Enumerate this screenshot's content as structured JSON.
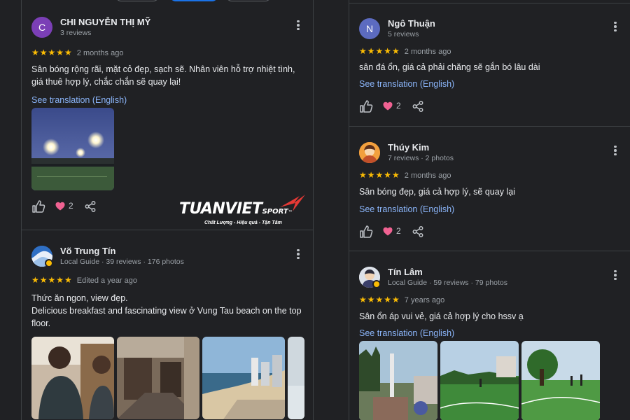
{
  "left": {
    "reviews": [
      {
        "avatar_letter": "C",
        "name": "CHI NGUYỄN THỊ MỸ",
        "meta": "3 reviews",
        "stars": "★★★★★",
        "when": "2 months ago",
        "text": "Sân bóng rộng rãi, mặt cỏ đẹp, sạch sẽ. Nhân viên hỗ trợ nhiệt tình, giá thuê hợp lý, chắc chắn sẽ quay lại!",
        "translate": "See translation (English)",
        "likes": "2"
      },
      {
        "name": "Võ Trung Tín",
        "meta": "Local Guide · 39 reviews · 176 photos",
        "stars": "★★★★★",
        "when": "Edited a year ago",
        "text_line1": "Thức ăn ngon, view đẹp.",
        "text_line2": "Delicious breakfast and fascinating view ở Vung Tau beach on the top floor."
      }
    ]
  },
  "right": {
    "reviews": [
      {
        "avatar_letter": "N",
        "name": "Ngô Thuận",
        "meta": "5 reviews",
        "stars": "★★★★★",
        "when": "2 months ago",
        "text": "sân đá ổn, giá cả phải chăng sẽ gắn bó lâu dài",
        "translate": "See translation (English)",
        "likes": "2"
      },
      {
        "name": "Thúy Kim",
        "meta": "7 reviews · 2 photos",
        "stars": "★★★★★",
        "when": "2 months ago",
        "text": "Sân bóng đẹp, giá cả hợp lý, sẽ quay lại",
        "translate": "See translation (English)",
        "likes": "2"
      },
      {
        "name": "Tín Lâm",
        "meta": "Local Guide · 59 reviews · 79 photos",
        "stars": "★★★★★",
        "when": "7 years ago",
        "text": "Sân ổn áp vui vẻ, giá cả hợp lý cho hssv ạ",
        "translate": "See translation (English)"
      }
    ]
  },
  "logo": {
    "main": "TUANVIET",
    "sport": "SPORT",
    "tm": "™",
    "tagline": "Chất Lượng - Hiệu quả - Tận Tâm"
  },
  "colors": {
    "background": "#202124",
    "star": "#fbbc04",
    "link": "#8ab4f8",
    "heart": "#f06292",
    "divider": "#3c4043",
    "logo_accent": "#e53935"
  },
  "icons": [
    "thumb-up-icon",
    "heart-icon",
    "share-icon",
    "more-vert-icon",
    "local-guide-badge-icon"
  ]
}
